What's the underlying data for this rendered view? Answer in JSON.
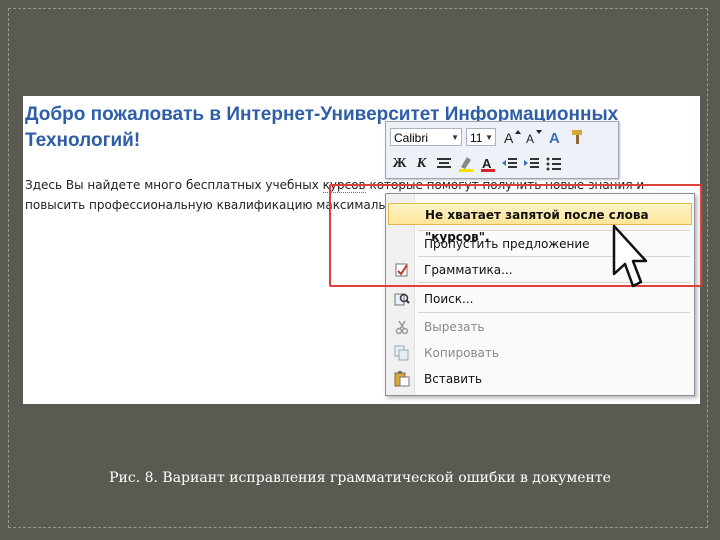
{
  "document": {
    "title": "Добро пожаловать в Интернет-Университет Информационных Технологий!",
    "body_line1_before": "Здесь Вы найдете много бесплатных учебных ",
    "body_line1_error": "курсов",
    "body_line1_after": " которые помогут получить новые знания и",
    "body_line2": "повысить профессиональную квалификацию максимально"
  },
  "minibar": {
    "font": "Calibri",
    "size": "11",
    "btn_bold": "Ж",
    "btn_italic": "К",
    "btn_font_color": "A"
  },
  "context_menu": {
    "items": [
      {
        "label": "Не хватает запятой после слова \"курсов\".",
        "highlighted": true
      },
      {
        "label": "Пропустить предложение"
      },
      {
        "label": "Грамматика..."
      },
      {
        "label": "Поиск..."
      },
      {
        "label": "Вырезать",
        "disabled": true
      },
      {
        "label": "Копировать",
        "disabled": true
      },
      {
        "label": "Вставить"
      }
    ]
  },
  "caption": "Рис. 8. Вариант исправления грамматической ошибки в документе",
  "colors": {
    "background": "#5a5a52",
    "title_blue": "#2e5ea8",
    "highlight_red": "#e0403a"
  }
}
